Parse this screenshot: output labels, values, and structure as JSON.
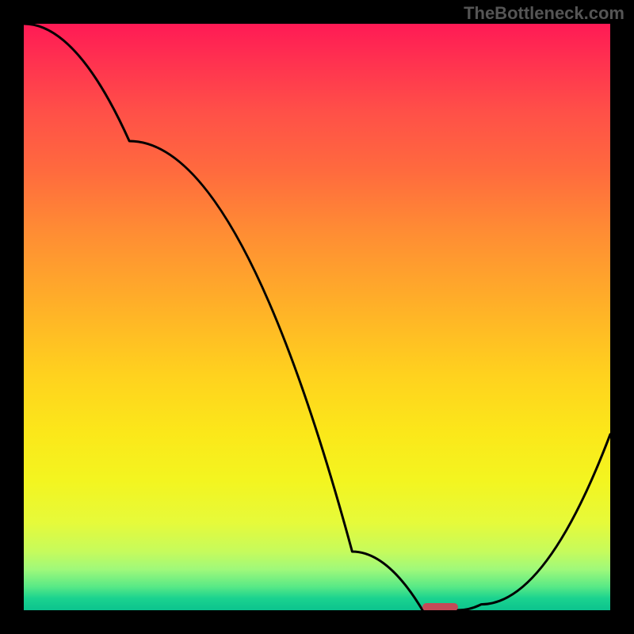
{
  "watermark": "TheBottleneck.com",
  "chart_data": {
    "type": "line",
    "title": "",
    "xlabel": "",
    "ylabel": "",
    "xlim": [
      0,
      100
    ],
    "ylim": [
      0,
      100
    ],
    "grid": false,
    "series": [
      {
        "name": "curve",
        "x": [
          0,
          18,
          56,
          68,
          74,
          78,
          100
        ],
        "values": [
          100,
          80,
          10,
          0,
          0,
          1,
          30
        ]
      }
    ],
    "marker": {
      "x": 71,
      "y": 0,
      "width_pct": 6,
      "height_pct": 1.4
    },
    "colors": {
      "gradient_top": "#ff1a55",
      "gradient_bottom": "#0cc48e",
      "line": "#000000",
      "marker": "#c44a57",
      "frame": "#000000"
    }
  }
}
